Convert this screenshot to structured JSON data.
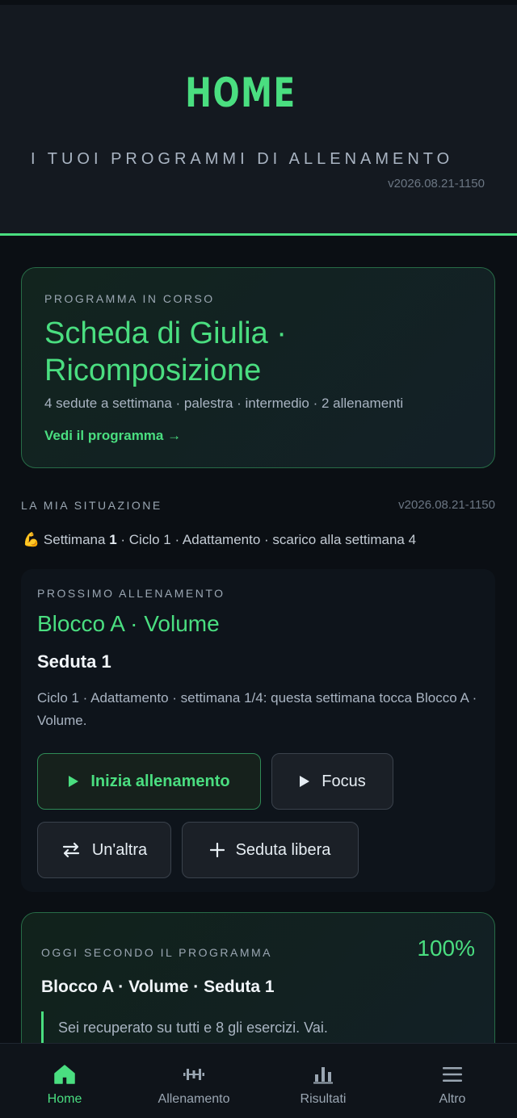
{
  "header": {
    "title": "HOME",
    "subtitle": "I TUOI PROGRAMMI DI ALLENAMENTO",
    "version": "v2026.08.21-1150"
  },
  "program": {
    "kicker": "PROGRAMMA IN CORSO",
    "name": "Scheda di Giulia · Ricomposizione",
    "meta": "4 sedute a settimana · palestra · intermedio · 2 allenamenti",
    "link": "Vedi il programma →"
  },
  "situation": {
    "label": "LA MIA SITUAZIONE",
    "version": "v2026.08.21-1150",
    "emoji": "💪",
    "week_prefix": "Settimana",
    "week_number": "1",
    "rest": "· Ciclo 1 · Adattamento · scarico alla settimana 4"
  },
  "next": {
    "kicker": "PROSSIMO ALLENAMENTO",
    "block": "Blocco A · Volume",
    "session": "Seduta 1",
    "description": "Ciclo 1 · Adattamento · settimana 1/4: questa settimana tocca Blocco A · Volume.",
    "buttons": {
      "start": "Inizia allenamento",
      "focus": "Focus",
      "another": "Un'altra",
      "free": "Seduta libera"
    }
  },
  "today": {
    "kicker": "OGGI SECONDO IL PROGRAMMA",
    "percent": "100%",
    "title": "Blocco A · Volume · Seduta 1",
    "note": "Sei recuperato su tutti e 8 gli esercizi. Vai."
  },
  "nav": {
    "items": [
      {
        "label": "Home",
        "icon": "home-icon",
        "active": true
      },
      {
        "label": "Allenamento",
        "icon": "dumbbell-icon",
        "active": false
      },
      {
        "label": "Risultati",
        "icon": "bar-chart-icon",
        "active": false
      },
      {
        "label": "Altro",
        "icon": "menu-icon",
        "active": false
      }
    ]
  },
  "colors": {
    "accent": "#4ade80",
    "background": "#0b0f14",
    "header": "#141920"
  }
}
